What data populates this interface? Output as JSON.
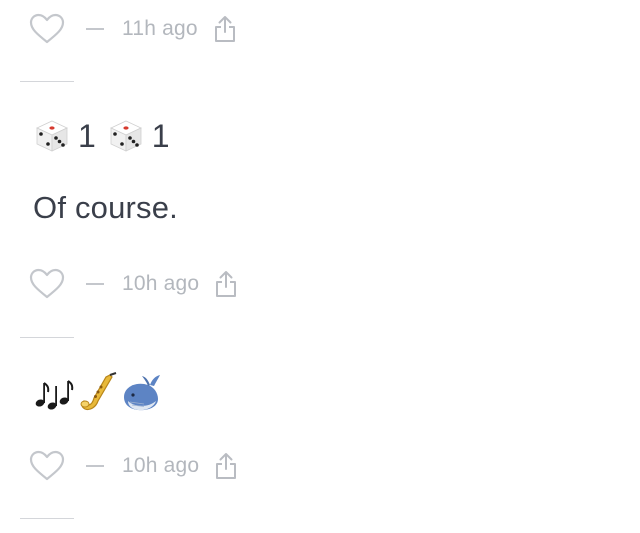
{
  "feed": {
    "items": [
      {
        "timestamp": "11h ago",
        "separator": "—"
      },
      {
        "dice_rolls": [
          {
            "icon": "die-icon",
            "value": "1"
          },
          {
            "icon": "die-icon",
            "value": "1"
          }
        ],
        "text": "Of course.",
        "timestamp": "10h ago",
        "separator": "—"
      },
      {
        "emojis": [
          "musical-notes-icon",
          "saxophone-icon",
          "whale-icon"
        ],
        "timestamp": "10h ago",
        "separator": "—"
      }
    ]
  },
  "colors": {
    "text": "#3a3f4a",
    "meta": "#b3b7bd",
    "divider": "#d4d6da"
  }
}
